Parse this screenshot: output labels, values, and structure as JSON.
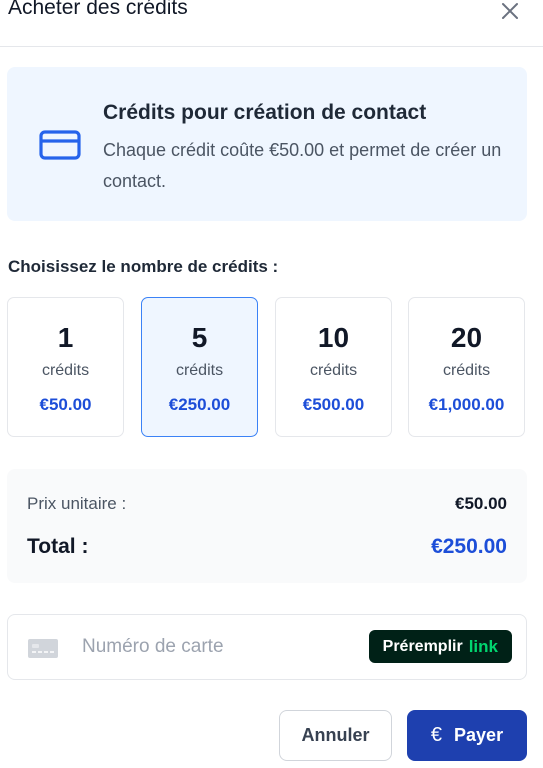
{
  "header": {
    "title": "Acheter des crédits",
    "close_icon": "close-icon"
  },
  "info": {
    "icon": "credit-card-icon",
    "title": "Crédits pour création de contact",
    "description": "Chaque crédit coûte €50.00 et permet de créer un contact."
  },
  "choose_label": "Choisissez le nombre de crédits :",
  "options": [
    {
      "count": "1",
      "unit": "crédits",
      "price": "€50.00",
      "selected": false
    },
    {
      "count": "5",
      "unit": "crédits",
      "price": "€250.00",
      "selected": true
    },
    {
      "count": "10",
      "unit": "crédits",
      "price": "€500.00",
      "selected": false
    },
    {
      "count": "20",
      "unit": "crédits",
      "price": "€1,000.00",
      "selected": false
    }
  ],
  "summary": {
    "unit_label": "Prix unitaire :",
    "unit_value": "€50.00",
    "total_label": "Total :",
    "total_value": "€250.00"
  },
  "payment": {
    "card_placeholder": "Numéro de carte",
    "card_value": "",
    "prefill_label": "Préremplir",
    "link_label": "link"
  },
  "actions": {
    "cancel_label": "Annuler",
    "pay_label": "Payer",
    "pay_icon": "€"
  },
  "colors": {
    "accent": "#1d4ed8",
    "primary_button": "#1e40af",
    "info_background": "#eff6ff",
    "link_background": "#002117",
    "link_green": "#00d66f"
  }
}
